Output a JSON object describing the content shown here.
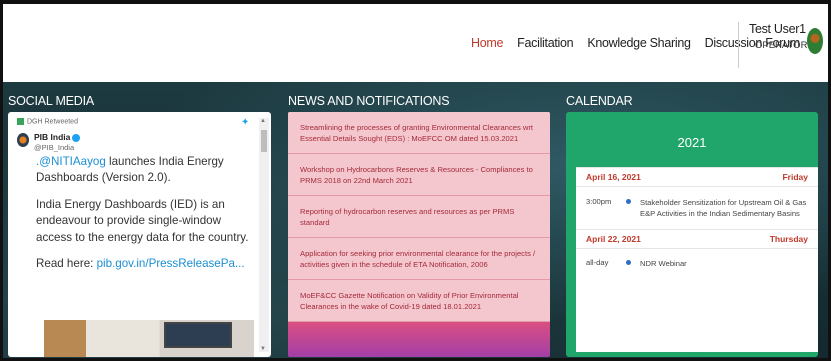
{
  "nav": {
    "items": [
      "Home",
      "Facilitation",
      "Knowledge Sharing",
      "Discussion Forum"
    ],
    "active": "Home"
  },
  "user": {
    "name": "Test User1",
    "role": "OPERATOR"
  },
  "social": {
    "title": "SOCIAL MEDIA",
    "retweet_label": "DGH Retweeted",
    "account_name": "PIB India",
    "account_handle": "@PIB_India",
    "tweet_mention": ".@NITIAayog",
    "tweet_line1": " launches India Energy Dashboards (Version 2.0).",
    "tweet_para2": "India Energy Dashboards (IED) is an endeavour to provide single-window access to the energy data for the country.",
    "tweet_read": "Read here: ",
    "tweet_link": "pib.gov.in/PressReleasePa..."
  },
  "news": {
    "title": "NEWS AND NOTIFICATIONS",
    "items": [
      "Streamlining the processes of granting Environmental Clearances wrt Essential Details Sought (EDS) : MoEFCC OM dated 15.03.2021",
      "Workshop on Hydrocarbons Reserves & Resources - Compliances to PRMS 2018 on 22nd March 2021",
      "Reporting of hydrocarbon reserves and resources as per PRMS standard",
      "Application for seeking prior environmental clearance for the projects / activities given in the schedule of ETA Notification, 2006",
      "MoEF&CC Gazette Notification on Validity of Prior Environmental Clearances in the wake of Covid-19 dated 18.01.2021"
    ]
  },
  "calendar": {
    "title": "CALENDAR",
    "year": "2021",
    "days": [
      {
        "date": "April 16, 2021",
        "weekday": "Friday",
        "event_time": "3:00pm",
        "event_title": "Stakeholder Sensitization for Upstream Oil & Gas E&P Activities in the Indian Sedimentary Basins"
      },
      {
        "date": "April 22, 2021",
        "weekday": "Thursday",
        "event_time": "all-day",
        "event_title": "NDR Webinar"
      }
    ]
  },
  "colors": {
    "accent_red": "#c0392b",
    "calendar_green": "#20a66a",
    "news_pink": "#f4c7ce",
    "twitter_blue": "#1da1f2"
  }
}
